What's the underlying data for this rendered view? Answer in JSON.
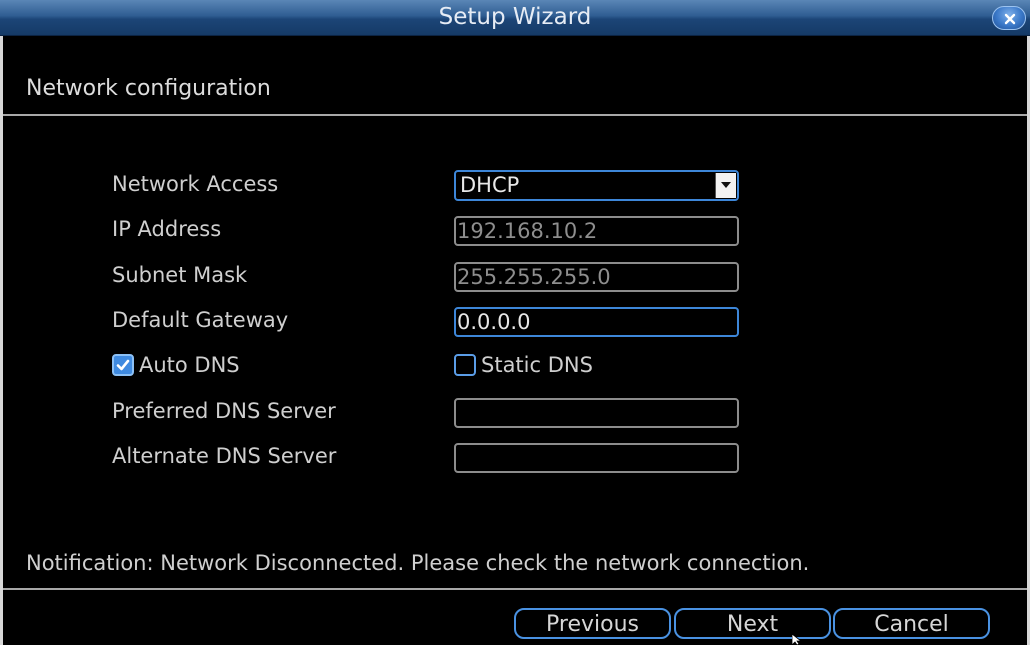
{
  "window": {
    "title": "Setup Wizard",
    "close_icon": "close-icon"
  },
  "section": {
    "title": "Network configuration"
  },
  "form": {
    "network_access": {
      "label": "Network Access",
      "value": "DHCP"
    },
    "ip_address": {
      "label": "IP Address",
      "value": "192.168.10.2"
    },
    "subnet_mask": {
      "label": "Subnet Mask",
      "value": "255.255.255.0"
    },
    "default_gateway": {
      "label": "Default Gateway",
      "value": "0.0.0.0"
    },
    "auto_dns": {
      "label": "Auto DNS",
      "checked": true
    },
    "static_dns": {
      "label": "Static DNS",
      "checked": false
    },
    "preferred_dns": {
      "label": "Preferred DNS Server",
      "value": ""
    },
    "alternate_dns": {
      "label": "Alternate DNS Server",
      "value": ""
    }
  },
  "notification": "Notification: Network Disconnected. Please check the network connection.",
  "buttons": {
    "previous": "Previous",
    "next": "Next",
    "cancel": "Cancel"
  },
  "colors": {
    "accent": "#3d86d8",
    "titlebar": "#1c4577",
    "background": "#000000"
  }
}
